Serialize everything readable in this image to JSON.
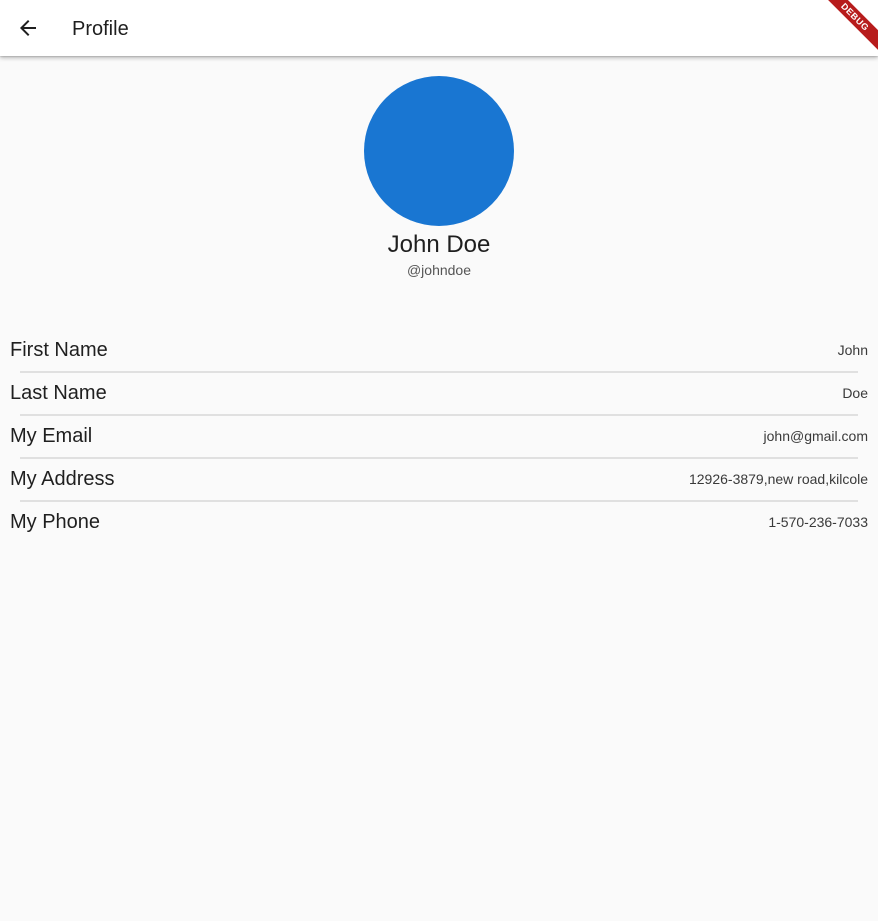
{
  "appbar": {
    "title": "Profile",
    "back_icon": "arrow-back-icon"
  },
  "debug_banner": "DEBUG",
  "profile": {
    "avatar_color": "#1976d2",
    "name": "John Doe",
    "username": "@johndoe"
  },
  "fields": [
    {
      "label": "First Name",
      "value": "John"
    },
    {
      "label": "Last Name",
      "value": "Doe"
    },
    {
      "label": "My Email",
      "value": "john@gmail.com"
    },
    {
      "label": "My Address",
      "value": "12926-3879,new road,kilcole"
    },
    {
      "label": "My Phone",
      "value": "1-570-236-7033"
    }
  ]
}
